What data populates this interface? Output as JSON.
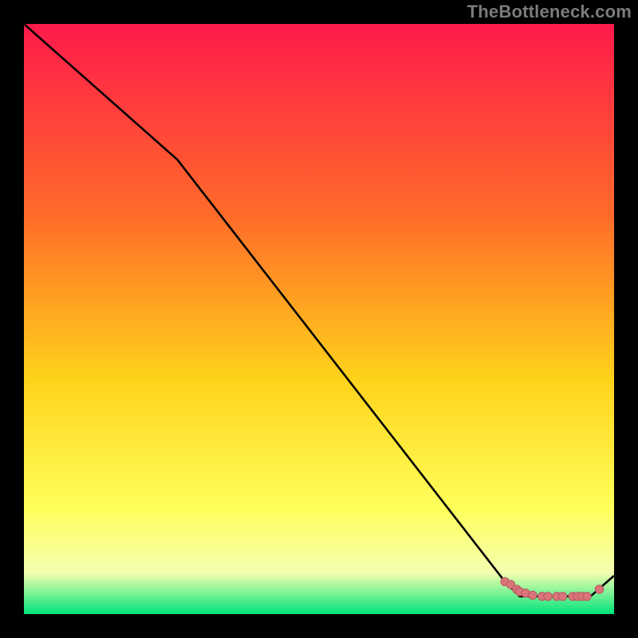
{
  "watermark": "TheBottleneck.com",
  "colors": {
    "page_bg": "#000000",
    "gradient_top": "#ff1a4b",
    "gradient_mid1": "#ff6a2a",
    "gradient_mid2": "#ffd21a",
    "gradient_mid3": "#ffff5a",
    "gradient_mid4": "#f4ffb0",
    "gradient_bottom": "#00e47a",
    "curve": "#000000",
    "dot_fill": "#d9747a",
    "dot_stroke": "#b85a60"
  },
  "chart_data": {
    "type": "line",
    "title": "",
    "xlabel": "",
    "ylabel": "",
    "xlim": [
      0,
      100
    ],
    "ylim": [
      0,
      100
    ],
    "grid": false,
    "legend": false,
    "background": "vertical-gradient",
    "series": [
      {
        "name": "bottleneck-curve",
        "x": [
          0,
          26,
          81.5,
          84,
          96,
          100
        ],
        "y": [
          100,
          77,
          5.5,
          3,
          3,
          6.5
        ]
      }
    ],
    "markers": {
      "name": "highlight-dots",
      "points": [
        {
          "x": 81.5,
          "y": 5.5
        },
        {
          "x": 82.5,
          "y": 5.0
        },
        {
          "x": 83.5,
          "y": 4.2
        },
        {
          "x": 84.0,
          "y": 3.8
        },
        {
          "x": 85.0,
          "y": 3.55
        },
        {
          "x": 86.2,
          "y": 3.2
        },
        {
          "x": 87.8,
          "y": 3.0
        },
        {
          "x": 88.8,
          "y": 3.0
        },
        {
          "x": 90.3,
          "y": 3.0
        },
        {
          "x": 91.3,
          "y": 3.0
        },
        {
          "x": 93.0,
          "y": 3.0
        },
        {
          "x": 93.8,
          "y": 3.0
        },
        {
          "x": 94.6,
          "y": 3.0
        },
        {
          "x": 95.4,
          "y": 3.0
        },
        {
          "x": 97.5,
          "y": 4.2
        }
      ]
    }
  }
}
